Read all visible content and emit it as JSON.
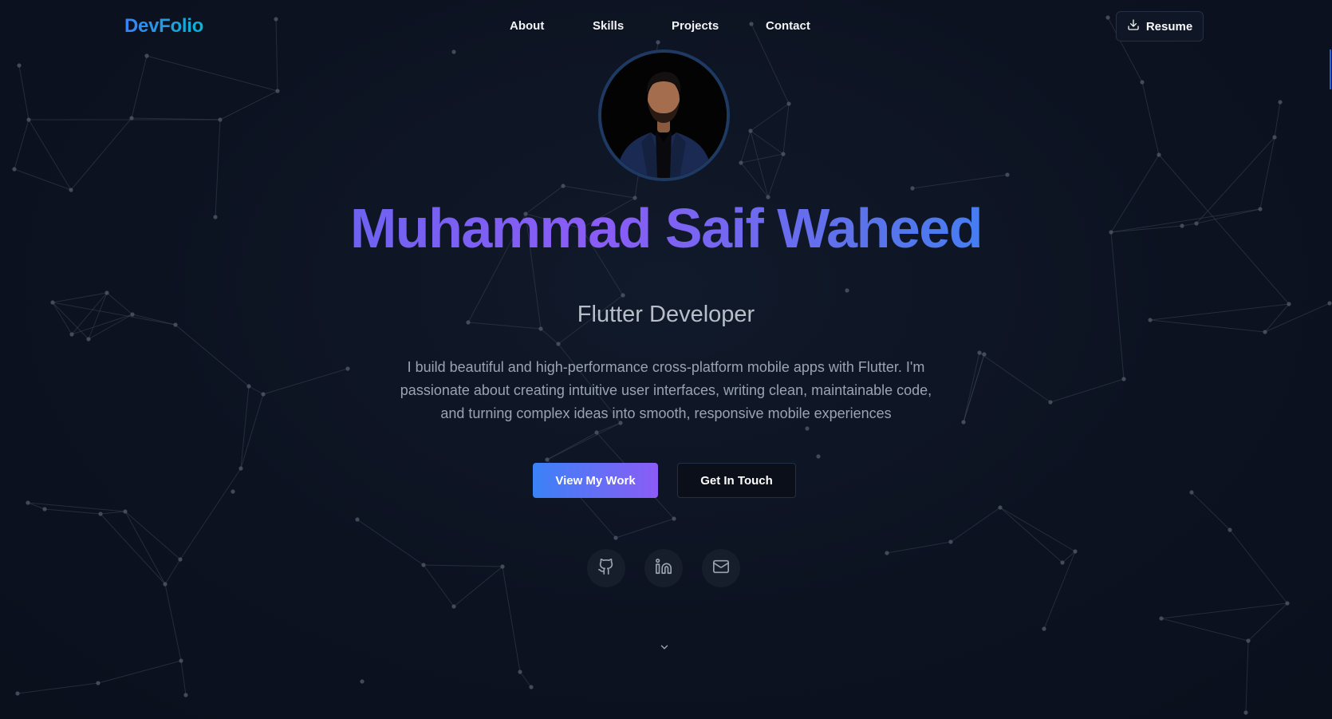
{
  "brand": {
    "logo_text": "DevFolio"
  },
  "nav": {
    "links": [
      {
        "label": "About"
      },
      {
        "label": "Skills"
      },
      {
        "label": "Projects"
      },
      {
        "label": "Contact"
      }
    ],
    "resume_label": "Resume"
  },
  "hero": {
    "name": "Muhammad Saif Waheed",
    "role": "Flutter Developer",
    "description": "I build beautiful and high-performance cross-platform mobile apps with Flutter. I'm passionate about creating intuitive user interfaces, writing clean, maintainable code, and turning complex ideas into smooth, responsive mobile experiences",
    "primary_button": "View My Work",
    "secondary_button": "Get In Touch"
  },
  "social": [
    {
      "icon": "github-icon"
    },
    {
      "icon": "linkedin-icon"
    },
    {
      "icon": "mail-icon"
    }
  ],
  "scroll": {
    "icon": "chevron-down-icon"
  },
  "colors": {
    "background": "#0d1421",
    "accent_blue": "#3b82f6",
    "accent_purple": "#8b5cf6",
    "accent_cyan": "#06b6d4",
    "network_line": "#3a4352",
    "network_dot": "#4b5563"
  }
}
